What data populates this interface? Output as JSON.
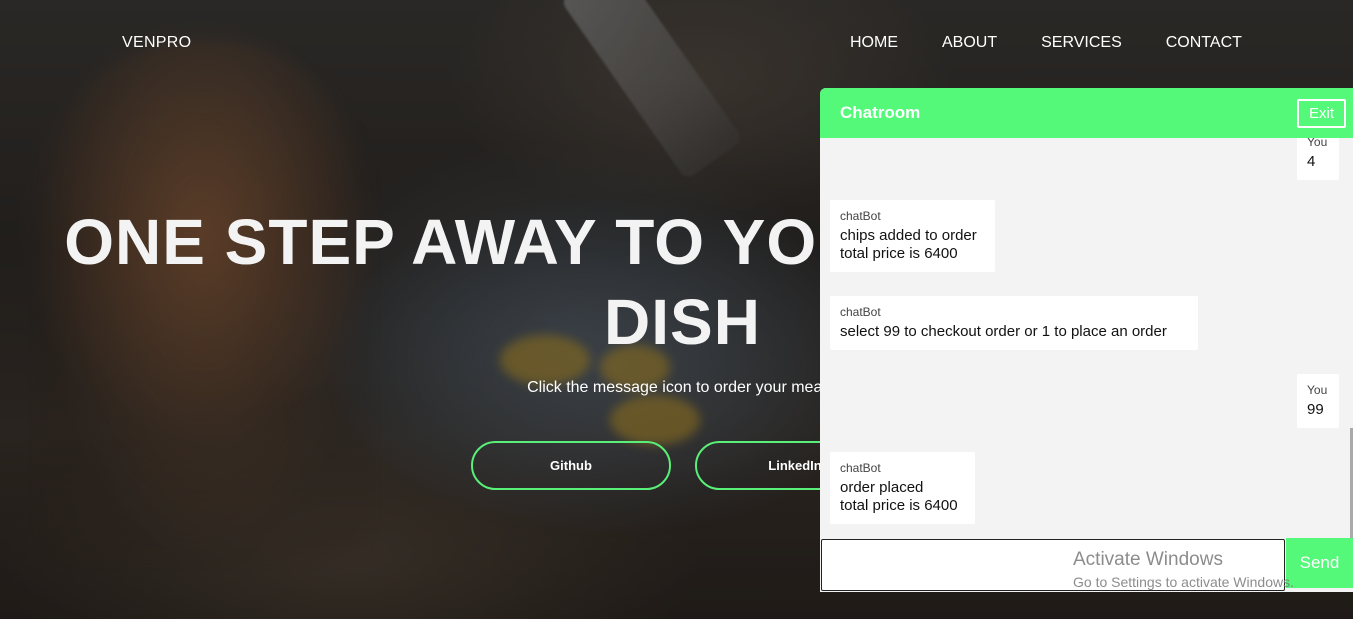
{
  "brand": "VENPRO",
  "nav": {
    "home": "HOME",
    "about": "ABOUT",
    "services": "SERVICES",
    "contact": "CONTACT"
  },
  "hero": {
    "title_line1": "ONE STEP AWAY TO YOUR FAVOURITE",
    "title_line2": "DISH",
    "subtitle": "Click the message icon to order your meal",
    "github_label": "Github",
    "linkedin_label": "LinkedIn"
  },
  "chat": {
    "title": "Chatroom",
    "exit_label": "Exit",
    "messages": [
      {
        "sender": "You",
        "text": "4"
      },
      {
        "sender": "chatBot",
        "text": "chips added to order\ntotal price is 6400"
      },
      {
        "sender": "chatBot",
        "text": "select 99 to checkout order or 1 to place an order"
      },
      {
        "sender": "You",
        "text": "99"
      },
      {
        "sender": "chatBot",
        "text": "order placed\ntotal price is 6400"
      }
    ],
    "input_value": "",
    "send_label": "Send"
  },
  "watermark": {
    "line1": "Activate Windows",
    "line2": "Go to Settings to activate Windows."
  },
  "colors": {
    "accent": "#55f97a",
    "button_border": "#58f078"
  }
}
